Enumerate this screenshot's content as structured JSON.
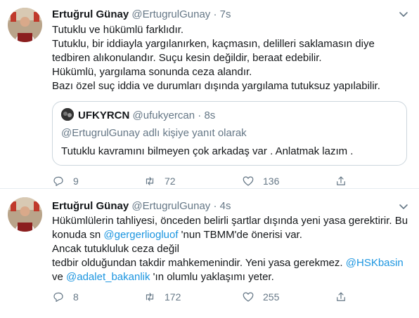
{
  "tweets": [
    {
      "name": "Ertuğrul Günay",
      "handle": "@ErtugrulGunay",
      "dot": "·",
      "time": "7s",
      "lines": [
        "Tutuklu ve hükümlü farklıdır.",
        "Tutuklu, bir iddiayla yargılanırken, kaçmasın, delilleri saklamasın diye",
        "tedbiren alıkonulandır. Suçu kesin değildir, beraat edebilir.",
        "Hükümlü, yargılama sonunda ceza alandır.",
        "Bazı özel suç iddia ve durumları dışında yargılama tutuksuz yapılabilir."
      ],
      "quote": {
        "name": "UFKYRCN",
        "handle": "@ufukyercan",
        "dot": "·",
        "time": "8s",
        "reply_context": "@ErtugrulGunay adlı kişiye yanıt olarak",
        "text": "Tutuklu kavramını bilmeyen çok arkadaş var . Anlatmak lazım ."
      },
      "replies": "9",
      "retweets": "72",
      "likes": "136"
    },
    {
      "name": "Ertuğrul Günay",
      "handle": "@ErtugrulGunay",
      "dot": "·",
      "time": "4s",
      "line1": "Hükümlülerin tahliyesi, önceden belirli şartlar dışında yeni yasa gerektirir. Bu",
      "line2_pre": "konuda sn ",
      "line2_mention": "@gergerliogluof",
      "line2_post": " 'nun TBMM'de önerisi var.",
      "line3": "Ancak tutukluluk ceza değil",
      "line4_pre": "tedbir olduğundan takdir mahkemenindir. Yeni yasa gerekmez. ",
      "line4_mention": "@HSKbasin",
      "line5_pre": " ve ",
      "line5_mention": "@adalet_bakanlik",
      "line5_post": " 'ın olumlu yaklaşımı yeter.",
      "replies": "8",
      "retweets": "172",
      "likes": "255"
    }
  ],
  "colors": {
    "accent": "#1b95e0",
    "muted": "#657786",
    "text": "#14171a",
    "border": "#ccd6dd"
  }
}
